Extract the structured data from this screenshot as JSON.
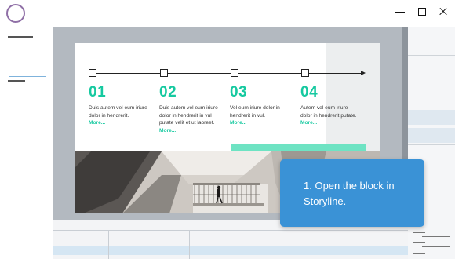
{
  "titlebar": {
    "logo_icon": "circle-logo-icon",
    "buttons": [
      "minimize-icon",
      "maximize-icon",
      "close-icon"
    ]
  },
  "colors": {
    "accent_green": "#16c9a0",
    "tooltip_blue": "#3a92d6",
    "logo_purple": "#8f6fa6"
  },
  "slide": {
    "steps": [
      {
        "number": "01",
        "text_lines": [
          "Duis autem vel eum iriure",
          "dolor in hendrerit."
        ],
        "more": "More..."
      },
      {
        "number": "02",
        "text_lines": [
          "Duis autem vel eum iriure",
          "dolor in hendrerit in vul",
          "putate velit et ut laoreet."
        ],
        "more": "More..."
      },
      {
        "number": "03",
        "text_lines": [
          "Vel eum iriure dolor in",
          "hendrerit in vul."
        ],
        "more": "More..."
      },
      {
        "number": "04",
        "text_lines": [
          "Autem vel eum iriure",
          "dolor in hendrerit putate."
        ],
        "more": "More..."
      }
    ]
  },
  "tooltip": {
    "text": "1. Open the block in Storyline."
  }
}
